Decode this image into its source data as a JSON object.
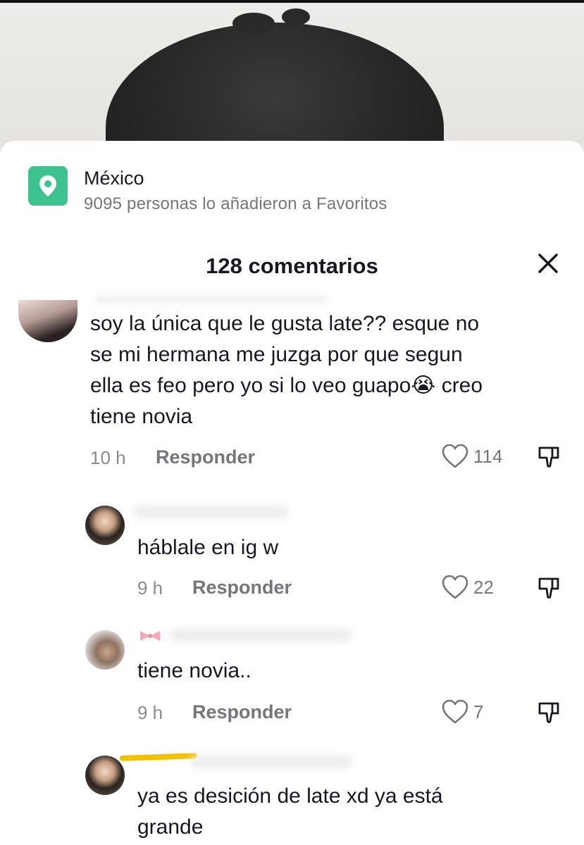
{
  "location": {
    "icon": "location-pin-icon",
    "title": "México",
    "subtitle": "9095 personas lo añadieron a Favoritos"
  },
  "comments_panel": {
    "title": "128 comentarios",
    "close_icon": "close-icon"
  },
  "comments": [
    {
      "text_lines": [
        "soy la única que le gusta late?? esque no",
        "se mi hermana me juzga por que segun",
        "ella es feo pero yo si lo veo guapo😭 creo",
        "tiene novia"
      ],
      "time": "10 h",
      "reply_label": "Responder",
      "likes": "114"
    },
    {
      "text_lines": [
        "háblale en ig w"
      ],
      "time": "9 h",
      "reply_label": "Responder",
      "likes": "22"
    },
    {
      "text_lines": [
        "tiene novia.."
      ],
      "time": "9 h",
      "reply_label": "Responder",
      "likes": "7"
    },
    {
      "text_lines": [
        "ya es desición de late xd ya está",
        "grande"
      ]
    }
  ],
  "colors": {
    "accent_location": "#3ec28f",
    "text_primary": "#161823",
    "text_secondary": "#75767c"
  }
}
